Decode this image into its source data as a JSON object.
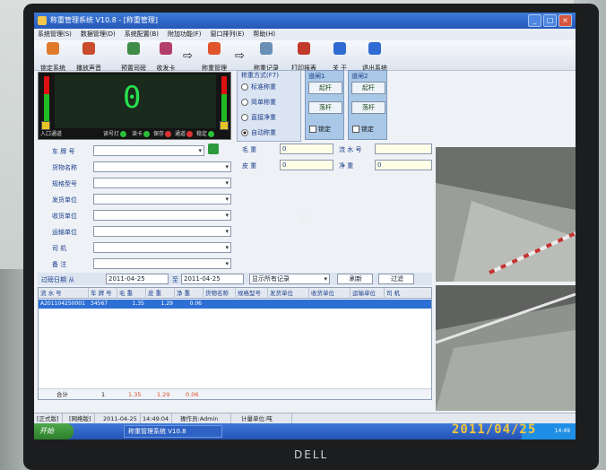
{
  "window": {
    "title": "称重管理系统 V10.8 - [称重管理]"
  },
  "menu": [
    "系统管理(S)",
    "数据管理(D)",
    "系统配置(B)",
    "附加功能(F)",
    "窗口排列(E)",
    "帮助(H)"
  ],
  "toolbar": [
    {
      "label": "锁定系统",
      "icon": "lock-icon"
    },
    {
      "label": "播放声音",
      "icon": "speaker-icon"
    },
    {
      "label": "预置司磅",
      "icon": "card-icon"
    },
    {
      "label": "收发卡",
      "icon": "card-icon"
    },
    {
      "label": "称重管理",
      "icon": "scale-icon"
    },
    {
      "label": "称重记录",
      "icon": "record-icon"
    },
    {
      "label": "打印报表",
      "icon": "print-icon"
    },
    {
      "label": "关 于",
      "icon": "info-icon"
    },
    {
      "label": "退出系统",
      "icon": "exit-icon"
    }
  ],
  "scale_panel": {
    "weight": "0",
    "label_left": "入口通道",
    "status_items": [
      "读号灯",
      "读卡",
      "保存",
      "通道",
      "稳定"
    ]
  },
  "weigh_mode": {
    "title": "称重方式(F7)",
    "options": [
      "标准称重",
      "简单称重",
      "直接净重",
      "自动称重"
    ],
    "selected": "自动称重"
  },
  "channel1": {
    "title": "道闸1",
    "up": "起杆",
    "down": "落杆",
    "lock": "锁定"
  },
  "channel2": {
    "title": "道闸2",
    "up": "起杆",
    "down": "落杆",
    "lock": "锁定"
  },
  "form": {
    "plate_label": "车 牌 号",
    "goods_label": "货物名称",
    "spec_label": "规格型号",
    "sender_label": "发货单位",
    "receiver_label": "收货单位",
    "transport_label": "运输单位",
    "driver_label": "司    机",
    "remark_label": "备    注",
    "gross_label": "毛    重",
    "gross_value": "0",
    "tare_label": "皮    重",
    "tare_value": "0",
    "serial_label": "流 水 号",
    "serial_value": "",
    "net_label": "净    重",
    "net_value": "0"
  },
  "filter": {
    "label": "过磅日期 从",
    "from": "2011-04-25",
    "to_label": "至",
    "to": "2011-04-25",
    "scope": "显示所有记录",
    "refresh": "刷新",
    "filter_btn": "过滤"
  },
  "table": {
    "columns": [
      "流 水 号",
      "车 牌 号",
      "毛    重",
      "皮    重",
      "净    重",
      "货物名称",
      "规格型号",
      "发货单位",
      "收货单位",
      "运输单位",
      "司    机"
    ],
    "rows": [
      [
        "A201104250001",
        "34567",
        "1.35",
        "1.29",
        "0.06",
        "",
        "",
        "",
        "",
        "",
        ""
      ]
    ],
    "footer": {
      "label": "合计",
      "count": "1",
      "gross": "1.35",
      "tare": "1.29",
      "net": "0.06"
    }
  },
  "statusbar": [
    "[正式版]",
    "[网络版]",
    "2011-04-25",
    "14:49:04",
    "操作员:Admin",
    "计量单位:吨"
  ],
  "taskbar": {
    "start": "开始",
    "task": "称重管理系统 V10.8",
    "clock": "14:49"
  },
  "photo": {
    "datestamp": "2011/04/25",
    "brand": "DELL"
  },
  "colors": {
    "title_blue": "#2458b8",
    "selected_row": "#2e6fd5",
    "led_green": "#29e04e",
    "footer_red": "#d9532b",
    "datestamp": "#f5c63a"
  }
}
